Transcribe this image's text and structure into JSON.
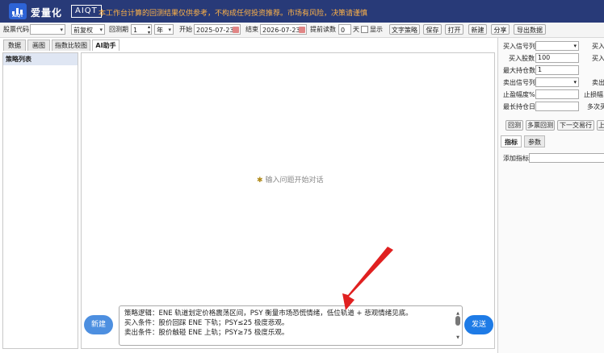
{
  "app": {
    "logo_label": "AIQT",
    "name": "爱量化",
    "badge": "AIQT",
    "disclaimer": "本工作台计算的回测结果仅供参考，不构成任何投资推荐。市场有风险，决策请谨慎"
  },
  "toolbar": {
    "stock_code_label": "股票代码",
    "stock_code_value": "",
    "adjust_value": "前复权",
    "period_label": "回测期",
    "period_value": "1",
    "period_unit": "年",
    "start_label": "开始",
    "start_date": "2025-07-23",
    "end_label": "结束",
    "end_date": "2026-07-23",
    "advance_label": "提前读数",
    "advance_value": "0",
    "advance_unit": "天",
    "show_label": "显示",
    "buttons": [
      "文字策略",
      "保存",
      "打开",
      "新建",
      "分享",
      "导出数据"
    ]
  },
  "tabs": [
    "数据",
    "画图",
    "指数比较图",
    "AI助手"
  ],
  "active_tab": "AI助手",
  "strategy_list": {
    "header": "策略列表"
  },
  "chat": {
    "empty_hint": "输入问题开始对话",
    "input_lines": [
      "策略逻辑：ENE 轨道划定价格震荡区间，PSY 衡量市场恐慌情绪，低位轨道 + 悲观情绪见底。",
      "买入条件：股价回踩 ENE 下轨；PSY≤25 极度悲观。",
      "卖出条件：股价触碰 ENE 上轨；PSY≥75 极度乐观。"
    ],
    "new_label": "新建",
    "send_label": "发送"
  },
  "right_panel": {
    "buy_signal_label": "买入信号列",
    "buy_signal_right": "买入",
    "buy_shares_label": "买入股数",
    "buy_shares_value": "100",
    "buy_shares_right": "买入",
    "max_hold_label": "最大持仓数",
    "max_hold_value": "1",
    "sell_signal_label": "卖出信号列",
    "sell_signal_right": "卖出",
    "take_profit_label": "止盈幅度%",
    "stop_loss_label": "止损幅",
    "max_days_label": "最长持仓日",
    "multi_label": "多次买",
    "actions": [
      "回测",
      "多票回测",
      "下一交易行",
      "上"
    ],
    "sub_tabs": [
      "指标",
      "参数"
    ],
    "add_indicator_label": "添加指标"
  }
}
